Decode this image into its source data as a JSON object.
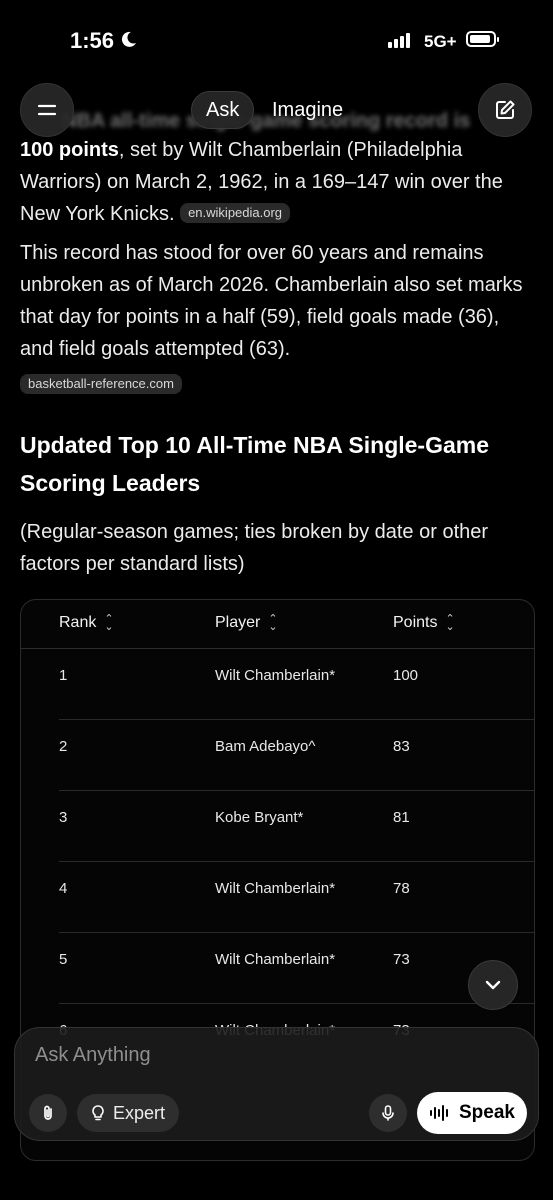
{
  "status_bar": {
    "time": "1:56",
    "network": "5G+"
  },
  "top_nav": {
    "tab_ask": "Ask",
    "tab_imagine": "Imagine",
    "blurred_heading": "NBA all-time single-game scoring record is"
  },
  "answer": {
    "para1_bold": "100 points",
    "para1_rest": ", set by Wilt Chamberlain (Philadelphia Warriors) on March 2, 1962, in a 169–147 win over the New York Knicks.",
    "source1": "en.wikipedia.org",
    "para2": "This record has stood for over 60 years and remains unbroken as of March 2026. Chamberlain also set marks that day for points in a half (59), field goals made (36), and field goals attempted (63).",
    "source2": "basketball-reference.com",
    "section_title": "Updated Top 10 All-Time NBA Single-Game Scoring Leaders",
    "subnote": "(Regular-season games; ties broken by date or other factors per standard lists)"
  },
  "table": {
    "headers": [
      "Rank",
      "Player",
      "Points"
    ],
    "rows": [
      {
        "rank": "1",
        "player": "Wilt Chamberlain*",
        "points": "100"
      },
      {
        "rank": "2",
        "player": "Bam Adebayo^",
        "points": "83"
      },
      {
        "rank": "3",
        "player": "Kobe Bryant*",
        "points": "81"
      },
      {
        "rank": "4",
        "player": "Wilt Chamberlain*",
        "points": "78"
      },
      {
        "rank": "5",
        "player": "Wilt Chamberlain*",
        "points": "73"
      },
      {
        "rank": "6",
        "player": "Wilt Chamberlain*",
        "points": "73"
      }
    ]
  },
  "composer": {
    "placeholder": "Ask Anything",
    "expert_label": "Expert",
    "speak_label": "Speak"
  },
  "icons": {
    "moon": "moon-icon",
    "menu": "hamburger-menu-icon",
    "edit": "compose-edit-icon",
    "scroll": "chevron-down-icon",
    "attach": "paperclip-icon",
    "expert": "lightbulb-icon",
    "mic": "microphone-icon",
    "speak": "audio-waveform-icon"
  }
}
